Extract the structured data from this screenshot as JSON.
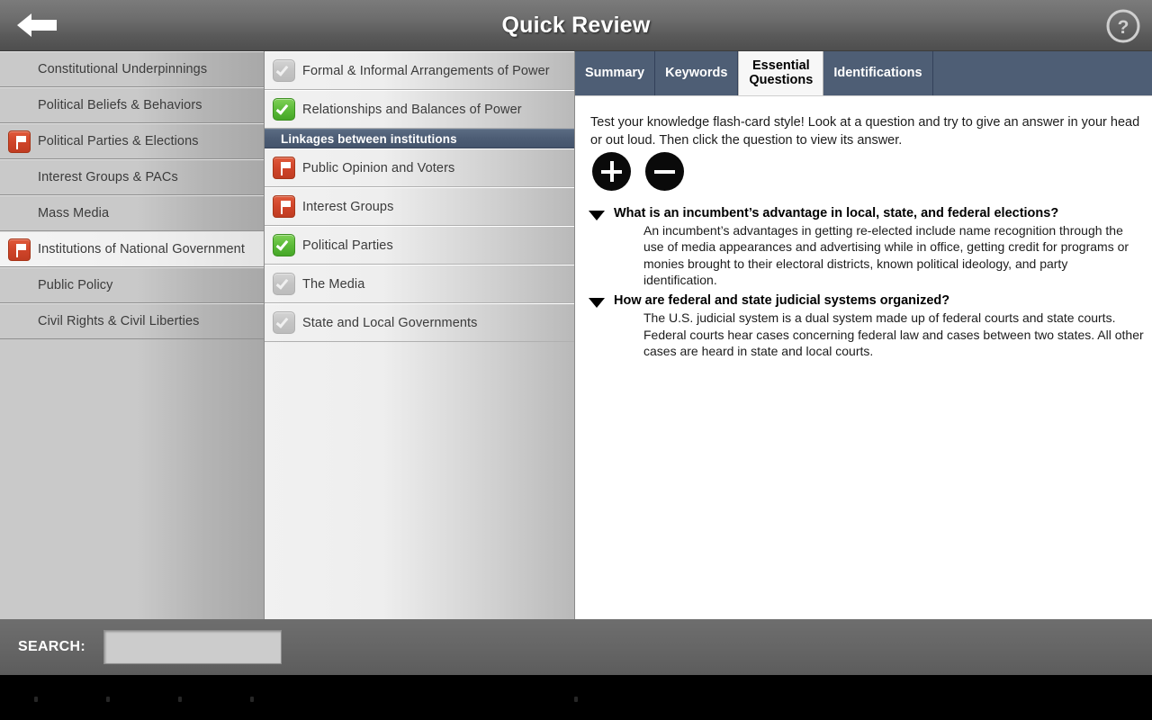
{
  "header": {
    "title": "Quick Review",
    "back_icon": "back-arrow-icon",
    "help_icon": "question-mark-circle-icon"
  },
  "sidebar": {
    "items": [
      {
        "label": "Constitutional Underpinnings",
        "icon": null,
        "selected": false
      },
      {
        "label": "Political Beliefs & Behaviors",
        "icon": null,
        "selected": false
      },
      {
        "label": "Political Parties & Elections",
        "icon": "flag-icon",
        "selected": false
      },
      {
        "label": "Interest Groups & PACs",
        "icon": null,
        "selected": false
      },
      {
        "label": "Mass Media",
        "icon": null,
        "selected": false
      },
      {
        "label": "Institutions of National Government",
        "icon": "flag-icon",
        "selected": true
      },
      {
        "label": "Public Policy",
        "icon": null,
        "selected": false
      },
      {
        "label": "Civil Rights & Civil Liberties",
        "icon": null,
        "selected": false
      }
    ]
  },
  "midpanel": {
    "items": [
      {
        "type": "item",
        "label": "Formal & Informal Arrangements of Power",
        "icon": "checkbox-gray-icon"
      },
      {
        "type": "item",
        "label": "Relationships and Balances of Power",
        "icon": "checkbox-green-icon"
      },
      {
        "type": "header",
        "label": "Linkages between institutions",
        "icon": null
      },
      {
        "type": "item",
        "label": "Public Opinion and Voters",
        "icon": "flag-icon"
      },
      {
        "type": "item",
        "label": "Interest Groups",
        "icon": "flag-icon"
      },
      {
        "type": "item",
        "label": "Political Parties",
        "icon": "checkbox-green-icon"
      },
      {
        "type": "item",
        "label": "The Media",
        "icon": "checkbox-gray-icon"
      },
      {
        "type": "item",
        "label": "State and Local Governments",
        "icon": "checkbox-gray-icon"
      }
    ]
  },
  "content": {
    "tabs": [
      {
        "label": "Summary",
        "active": false
      },
      {
        "label": "Keywords",
        "active": false
      },
      {
        "label": "Essential\nQuestions",
        "active": true
      },
      {
        "label": "Identifications",
        "active": false
      }
    ],
    "intro": "Test your knowledge flash-card style! Look at a question and try to give an answer in your head or out loud. Then click the question to view its answer.",
    "expand_all_label": "+",
    "collapse_all_label": "−",
    "questions": [
      {
        "question": "What is an incumbent’s advantage in local, state, and federal elections?",
        "answer": "An incumbent’s advantages in getting re-elected include name recognition through the use of media appearances and advertising while in office, getting credit for programs or monies brought to their electoral districts, known political ideology, and party identification.",
        "expanded": true
      },
      {
        "question": "How are federal and state judicial systems organized?",
        "answer": "The U.S. judicial system is a dual system made up of federal courts and state courts. Federal courts hear cases concerning federal law and cases between two states. All other cases are heard in state and local courts.",
        "expanded": true
      }
    ]
  },
  "search": {
    "label": "SEARCH:",
    "value": "",
    "placeholder": ""
  },
  "colors": {
    "tab_bar": "#4e5e75",
    "header_row": "#4c5c74",
    "flag_red": "#d0452a",
    "check_green": "#5cbb39",
    "check_gray": "#c4c4c4"
  }
}
